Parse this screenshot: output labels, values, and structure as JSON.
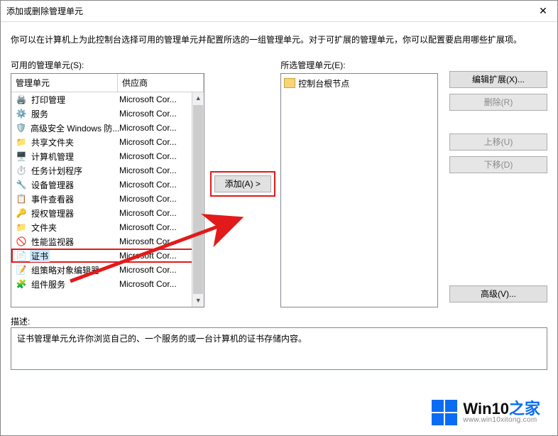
{
  "window": {
    "title": "添加或删除管理单元",
    "close": "✕"
  },
  "instruction": "你可以在计算机上为此控制台选择可用的管理单元并配置所选的一组管理单元。对于可扩展的管理单元，你可以配置要启用哪些扩展项。",
  "available": {
    "label": "可用的管理单元(S):",
    "columns": {
      "name": "管理单元",
      "vendor": "供应商"
    },
    "items": [
      {
        "icon": "printer-icon",
        "name": "打印管理",
        "vendor": "Microsoft Cor..."
      },
      {
        "icon": "gear-icon",
        "name": "服务",
        "vendor": "Microsoft Cor..."
      },
      {
        "icon": "shield-icon",
        "name": "高级安全 Windows 防...",
        "vendor": "Microsoft Cor..."
      },
      {
        "icon": "folder-icon",
        "name": "共享文件夹",
        "vendor": "Microsoft Cor..."
      },
      {
        "icon": "pc-icon",
        "name": "计算机管理",
        "vendor": "Microsoft Cor..."
      },
      {
        "icon": "clock-icon",
        "name": "任务计划程序",
        "vendor": "Microsoft Cor..."
      },
      {
        "icon": "device-icon",
        "name": "设备管理器",
        "vendor": "Microsoft Cor..."
      },
      {
        "icon": "event-icon",
        "name": "事件查看器",
        "vendor": "Microsoft Cor..."
      },
      {
        "icon": "auth-icon",
        "name": "授权管理器",
        "vendor": "Microsoft Cor..."
      },
      {
        "icon": "folder-icon",
        "name": "文件夹",
        "vendor": "Microsoft Cor..."
      },
      {
        "icon": "perf-icon",
        "name": "性能监视器",
        "vendor": "Microsoft Cor..."
      },
      {
        "icon": "cert-icon",
        "name": "证书",
        "vendor": "Microsoft Cor...",
        "selected": true,
        "boxed": true
      },
      {
        "icon": "gpedit-icon",
        "name": "组策略对象编辑器",
        "vendor": "Microsoft Cor..."
      },
      {
        "icon": "comp-icon",
        "name": "组件服务",
        "vendor": "Microsoft Cor..."
      }
    ]
  },
  "addButton": "添加(A) >",
  "selected": {
    "label": "所选管理单元(E):",
    "root": "控制台根节点"
  },
  "sideButtons": {
    "editExt": "编辑扩展(X)...",
    "remove": "删除(R)",
    "moveUp": "上移(U)",
    "moveDown": "下移(D)",
    "advanced": "高级(V)..."
  },
  "description": {
    "label": "描述:",
    "text": "证书管理单元允许你浏览自己的、一个服务的或一台计算机的证书存储内容。"
  },
  "watermark": {
    "brand_pre": "Win10",
    "brand_post": "之家",
    "url": "www.win10xitong.com"
  }
}
